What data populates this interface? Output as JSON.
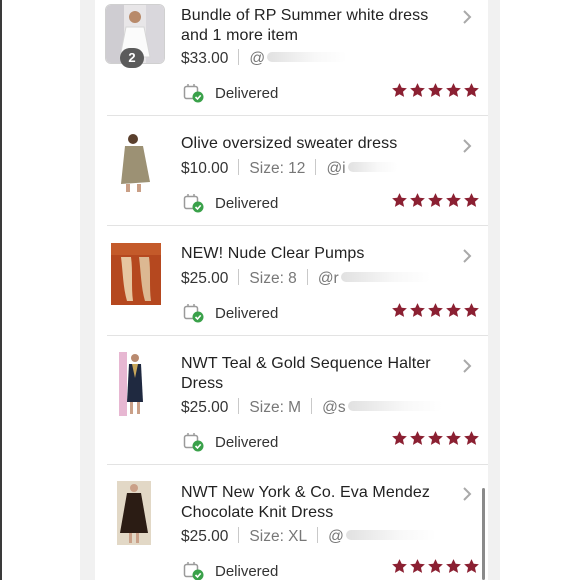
{
  "colors": {
    "star": "#8b2032",
    "delivered_check": "#3aa14a"
  },
  "orders": [
    {
      "title": "Bundle of RP Summer white dress and 1 more item",
      "price": "$33.00",
      "size": "",
      "seller": "@",
      "status": "Delivered",
      "rating": 5,
      "badge": "2",
      "thumb": "white-dress-photo"
    },
    {
      "title": "Olive oversized sweater dress",
      "price": "$10.00",
      "size": "Size: 12",
      "seller": "@i",
      "status": "Delivered",
      "rating": 5,
      "thumb": "olive-dress-photo"
    },
    {
      "title": "NEW! Nude Clear Pumps",
      "price": "$25.00",
      "size": "Size: 8",
      "seller": "@r",
      "status": "Delivered",
      "rating": 5,
      "thumb": "nude-pumps-photo"
    },
    {
      "title": "NWT Teal & Gold Sequence Halter Dress",
      "price": "$25.00",
      "size": "Size: M",
      "seller": "@s",
      "status": "Delivered",
      "rating": 5,
      "thumb": "teal-dress-photo"
    },
    {
      "title": "NWT New York & Co. Eva Mendez Chocolate Knit Dress",
      "price": "$25.00",
      "size": "Size: XL",
      "seller": "@",
      "status": "Delivered",
      "rating": 5,
      "thumb": "knit-dress-photo"
    }
  ]
}
